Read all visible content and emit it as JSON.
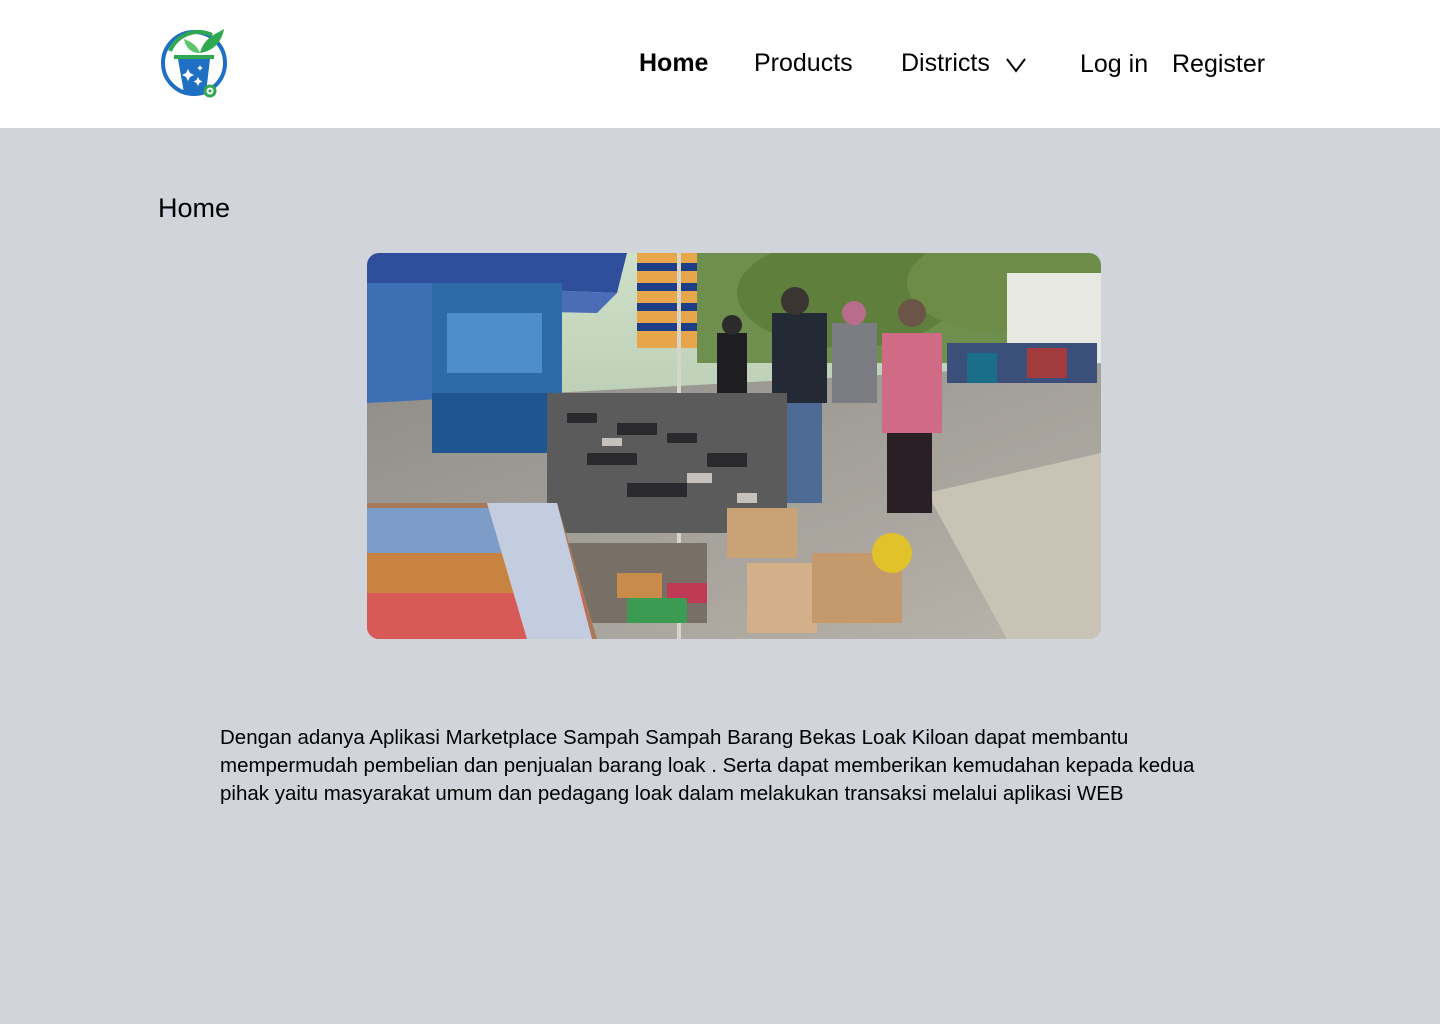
{
  "header": {
    "logo_name": "marketplace-logo",
    "nav": {
      "home": "Home",
      "products": "Products",
      "districts": "Districts"
    },
    "auth": {
      "login": "Log in",
      "register": "Register"
    }
  },
  "main": {
    "title": "Home",
    "description": "Dengan adanya Aplikasi Marketplace Sampah Sampah Barang Bekas Loak Kiloan dapat membantu mempermudah pembelian dan penjualan barang loak . Serta dapat memberikan kemudahan kepada kedua pihak yaitu masyarakat umum dan pedagang loak dalam melakukan transaksi melalui aplikasi WEB"
  },
  "colors": {
    "header_bg": "#ffffff",
    "page_bg": "#d1d4db",
    "logo_blue": "#1f6fc4",
    "logo_green": "#2fa84f"
  }
}
